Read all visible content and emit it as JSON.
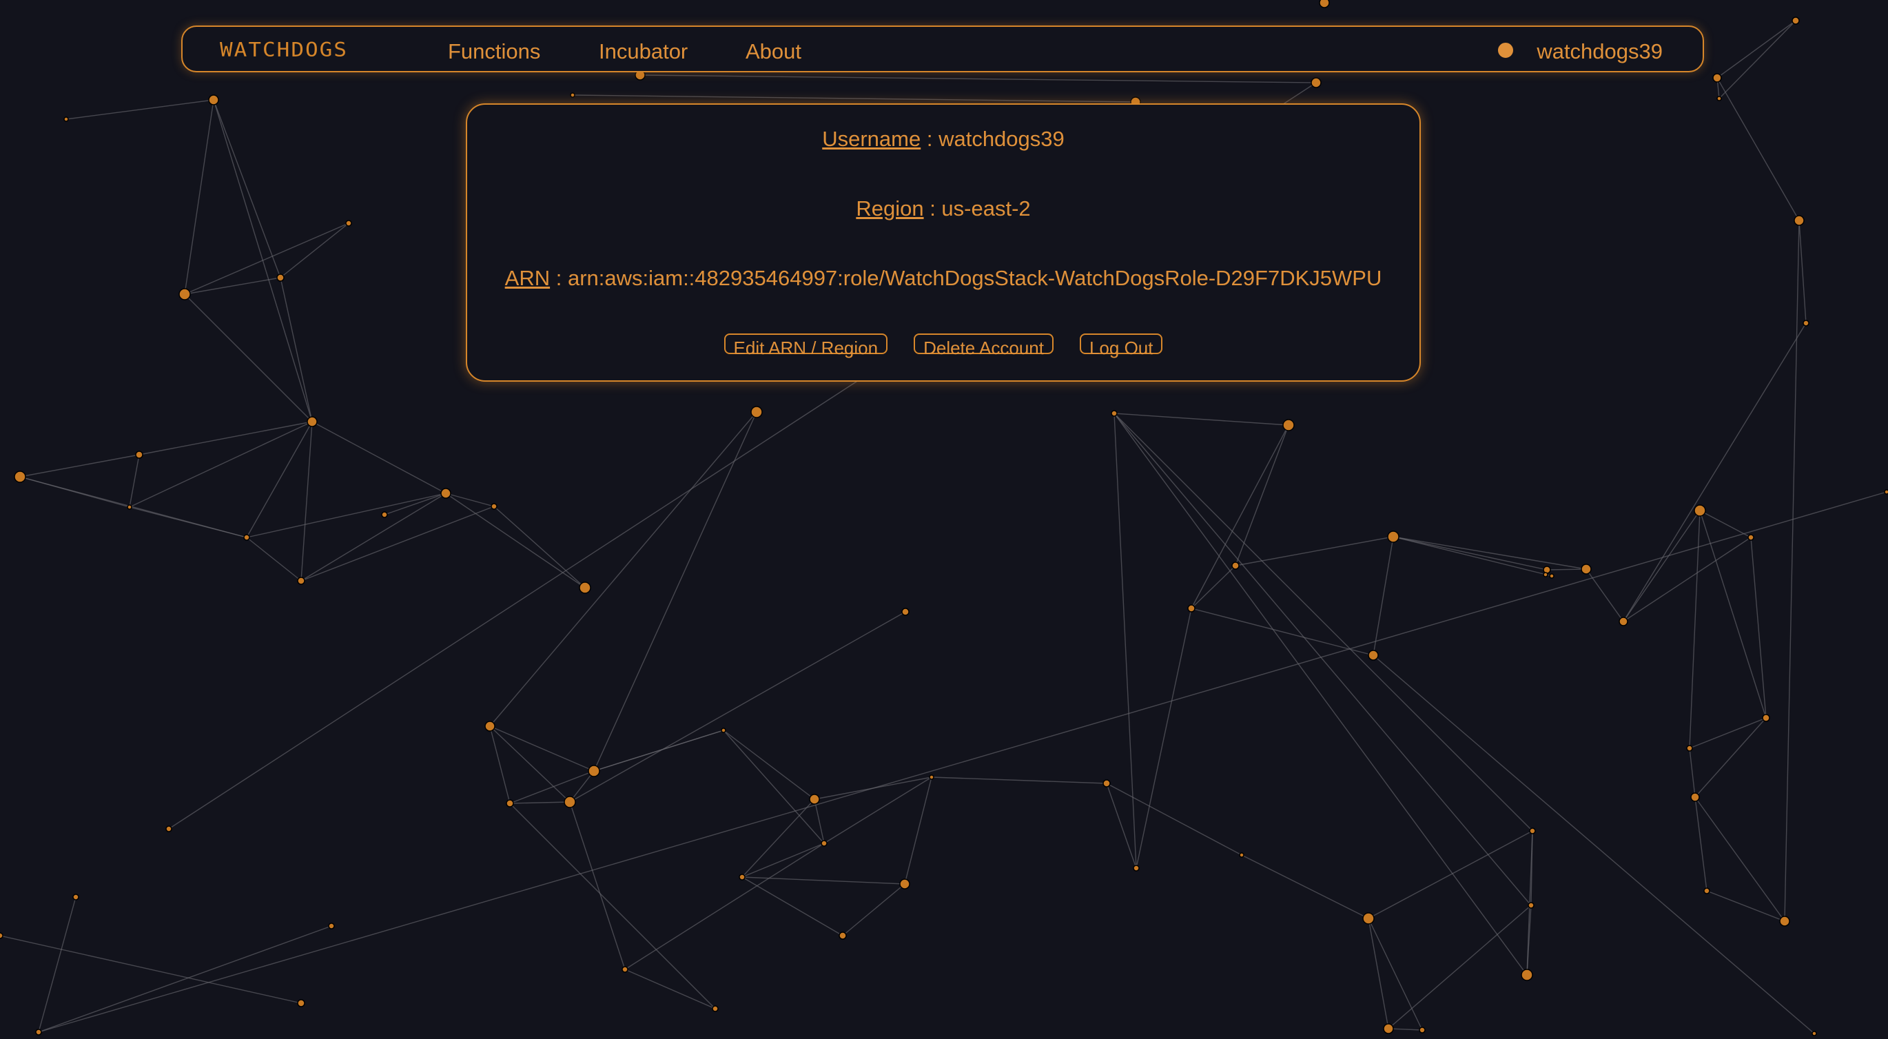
{
  "nav": {
    "logo": "WATCHDOGS",
    "links": [
      "Functions",
      "Incubator",
      "About"
    ],
    "user": "watchdogs39",
    "user_icon": "user-icon"
  },
  "profile": {
    "fields": [
      {
        "label": "Username",
        "sep": " : ",
        "value": "watchdogs39"
      },
      {
        "label": "Region",
        "sep": " : ",
        "value": "us-east-2"
      },
      {
        "label": "ARN",
        "sep": " : ",
        "value": "arn:aws:iam::482935464997:role/WatchDogsStack-WatchDogsRole-D29F7DKJ5WPU"
      }
    ],
    "buttons": {
      "edit": "Edit ARN / Region",
      "delete": "Delete Account",
      "logout": "Log Out"
    }
  },
  "colors": {
    "background": "#12131c",
    "accent": "#d6862a",
    "text": "#e0913a",
    "node": "#c97a22",
    "edge": "#6a6a72"
  }
}
